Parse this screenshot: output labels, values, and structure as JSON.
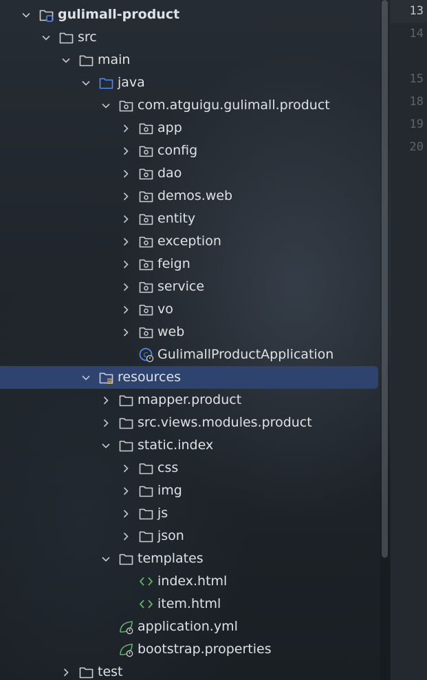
{
  "project_tree": {
    "items": [
      {
        "label": "gulimall-product",
        "depth": 0,
        "expanded": true,
        "icon": "module-folder-icon",
        "bold": true
      },
      {
        "label": "src",
        "depth": 1,
        "expanded": true,
        "icon": "folder-icon"
      },
      {
        "label": "main",
        "depth": 2,
        "expanded": true,
        "icon": "folder-icon"
      },
      {
        "label": "java",
        "depth": 3,
        "expanded": true,
        "icon": "source-folder-icon"
      },
      {
        "label": "com.atguigu.gulimall.product",
        "depth": 4,
        "expanded": true,
        "icon": "package-icon"
      },
      {
        "label": "app",
        "depth": 5,
        "expanded": false,
        "icon": "package-icon"
      },
      {
        "label": "config",
        "depth": 5,
        "expanded": false,
        "icon": "package-icon"
      },
      {
        "label": "dao",
        "depth": 5,
        "expanded": false,
        "icon": "package-icon"
      },
      {
        "label": "demos.web",
        "depth": 5,
        "expanded": false,
        "icon": "package-icon"
      },
      {
        "label": "entity",
        "depth": 5,
        "expanded": false,
        "icon": "package-icon"
      },
      {
        "label": "exception",
        "depth": 5,
        "expanded": false,
        "icon": "package-icon"
      },
      {
        "label": "feign",
        "depth": 5,
        "expanded": false,
        "icon": "package-icon"
      },
      {
        "label": "service",
        "depth": 5,
        "expanded": false,
        "icon": "package-icon"
      },
      {
        "label": "vo",
        "depth": 5,
        "expanded": false,
        "icon": "package-icon"
      },
      {
        "label": "web",
        "depth": 5,
        "expanded": false,
        "icon": "package-icon"
      },
      {
        "label": "GulimallProductApplication",
        "depth": 5,
        "expanded": null,
        "icon": "spring-boot-class-icon"
      },
      {
        "label": "resources",
        "depth": 3,
        "expanded": true,
        "icon": "resources-folder-icon",
        "selected": true
      },
      {
        "label": "mapper.product",
        "depth": 4,
        "expanded": false,
        "icon": "folder-icon"
      },
      {
        "label": "src.views.modules.product",
        "depth": 4,
        "expanded": false,
        "icon": "folder-icon"
      },
      {
        "label": "static.index",
        "depth": 4,
        "expanded": true,
        "icon": "folder-icon"
      },
      {
        "label": "css",
        "depth": 5,
        "expanded": false,
        "icon": "folder-icon"
      },
      {
        "label": "img",
        "depth": 5,
        "expanded": false,
        "icon": "folder-icon"
      },
      {
        "label": "js",
        "depth": 5,
        "expanded": false,
        "icon": "folder-icon"
      },
      {
        "label": "json",
        "depth": 5,
        "expanded": false,
        "icon": "folder-icon"
      },
      {
        "label": "templates",
        "depth": 4,
        "expanded": true,
        "icon": "folder-icon"
      },
      {
        "label": "index.html",
        "depth": 5,
        "expanded": null,
        "icon": "html-file-icon"
      },
      {
        "label": "item.html",
        "depth": 5,
        "expanded": null,
        "icon": "html-file-icon"
      },
      {
        "label": "application.yml",
        "depth": 4,
        "expanded": null,
        "icon": "spring-config-icon"
      },
      {
        "label": "bootstrap.properties",
        "depth": 4,
        "expanded": null,
        "icon": "spring-config-icon"
      },
      {
        "label": "test",
        "depth": 2,
        "expanded": false,
        "icon": "folder-icon"
      }
    ]
  },
  "editor_gutter": {
    "line_numbers": [
      "13",
      "14",
      "15",
      "18",
      "19",
      "20"
    ],
    "current_line": "13"
  },
  "colors": {
    "text": "#dfe1e5",
    "selection": "#2e436e",
    "folder_outline": "#ced0d6",
    "source_folder": "#548af7",
    "html_icon": "#5fb865",
    "spring_icon": "#5fb865",
    "line_number": "#5e6369"
  }
}
